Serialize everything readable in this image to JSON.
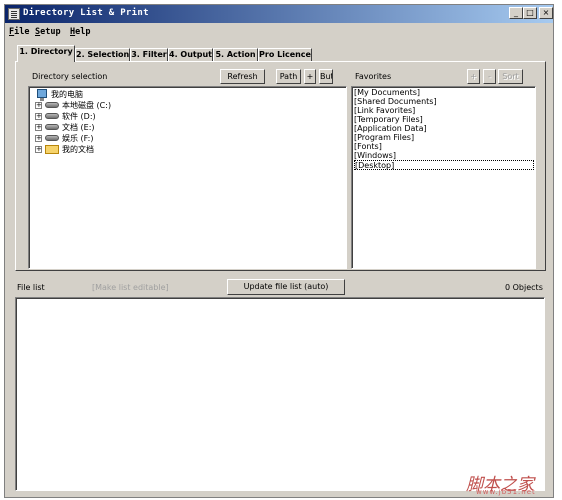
{
  "window": {
    "title": "Directory List & Print",
    "controls": {
      "minimize": "_",
      "maximize": "□",
      "close": "×"
    }
  },
  "menu": [
    {
      "key": "F",
      "rest": "ile"
    },
    {
      "key": "S",
      "rest": "etup"
    },
    {
      "key": "H",
      "rest": "elp"
    }
  ],
  "tabs": [
    "1. Directory",
    "2. Selection",
    "3. Filter",
    "4. Output",
    "5. Action",
    "Pro Licence"
  ],
  "directory": {
    "label": "Directory selection",
    "refresh_label": "Refresh",
    "path_label": "Path",
    "plus_label": "+",
    "truncated_label": "Butt",
    "tree": [
      {
        "label": "我的电脑",
        "icon": "computer-icon",
        "expander": ""
      },
      {
        "label": "本地磁盘 (C:)",
        "icon": "drive-icon",
        "expander": "+"
      },
      {
        "label": "软件 (D:)",
        "icon": "drive-icon",
        "expander": "+"
      },
      {
        "label": "文档 (E:)",
        "icon": "drive-icon",
        "expander": "+"
      },
      {
        "label": "娱乐 (F:)",
        "icon": "drive-icon",
        "expander": "+"
      },
      {
        "label": "我的文档",
        "icon": "folder-icon",
        "expander": "+"
      }
    ]
  },
  "favorites": {
    "label": "Favorites",
    "add_label": "+",
    "remove_label": "-",
    "sort_label": "Sort",
    "items": [
      "[My Documents]",
      "[Shared Documents]",
      "[Link Favorites]",
      "[Temporary Files]",
      "[Application Data]",
      "[Program Files]",
      "[Fonts]",
      "[Windows]",
      "[Desktop]"
    ],
    "selected": "[Desktop]"
  },
  "file_list": {
    "label": "File list",
    "edit_hint": "[Make list editable]",
    "update_label": "Update file list (auto)",
    "count": "0 Objects"
  },
  "watermark": {
    "text": "脚本之家",
    "url": "www.jb51.net"
  }
}
